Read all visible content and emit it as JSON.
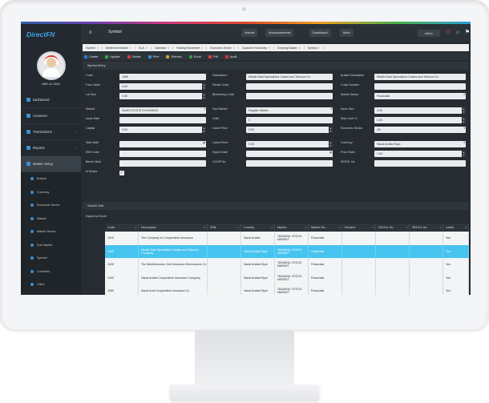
{
  "app": {
    "logo": "DirectFN",
    "breadcrumb": "Symbol",
    "top_buttons": [
      "Actions",
      "Announcements",
      "Dashboard",
      "More"
    ],
    "user_menu": "Admin"
  },
  "user": {
    "name": "ABD AL BAS"
  },
  "sidebar": {
    "items": [
      {
        "label": "Dashboard"
      },
      {
        "label": "Customer"
      },
      {
        "label": "Transactions"
      },
      {
        "label": "Reports"
      },
      {
        "label": "Master Setup"
      }
    ],
    "sub_items": [
      "Branch",
      "Currency",
      "Economic Sector",
      "Market",
      "Market Sector",
      "Sub Market",
      "Symbol",
      "Countries",
      "Cities"
    ]
  },
  "tabs": [
    "Symbol",
    "Settlement Master",
    "SLA",
    "Calendar",
    "Holding Movement",
    "Economic Sector",
    "Customer Summary",
    "Clearing Master",
    "Symbol"
  ],
  "actions": [
    {
      "label": "Create",
      "color": "#2a7bd0"
    },
    {
      "label": "Update",
      "color": "#3aa845"
    },
    {
      "label": "Delete",
      "color": "#d83a3a"
    },
    {
      "label": "Print",
      "color": "#3a8fd6"
    },
    {
      "label": "Refresh",
      "color": "#d8a23a"
    },
    {
      "label": "Excel",
      "color": "#2e9a48"
    },
    {
      "label": "Pdf",
      "color": "#d8443a"
    },
    {
      "label": "Audit",
      "color": "#c93a3a"
    }
  ],
  "form": {
    "title": "Symbol Entry",
    "fields": {
      "code": {
        "label": "Code",
        "value": "1050"
      },
      "face_value": {
        "label": "Face Value",
        "value": "0.00"
      },
      "lot_size": {
        "label": "Lot Size",
        "value": "0.00"
      },
      "market": {
        "label": "Market",
        "value": "SAUDI STOCK EXCHANGE"
      },
      "issue_date": {
        "label": "Issue Date",
        "value": ""
      },
      "capital": {
        "label": "Capital",
        "value": "0.00"
      },
      "start_date": {
        "label": "Start Date",
        "value": ""
      },
      "isin_code": {
        "label": "ISIN Code",
        "value": ""
      },
      "bench_mark": {
        "label": "Bench Mark",
        "value": ""
      },
      "is_shariya": {
        "label": "Is Sharia"
      },
      "description": {
        "label": "Description",
        "value": "Middle East Specialized Cables and Telecom Co"
      },
      "reuter_code": {
        "label": "Reuter Code",
        "value": ""
      },
      "bloomberg_code": {
        "label": "Bloomberg Code",
        "value": ""
      },
      "sub_market": {
        "label": "Sub Market",
        "value": "Regular Market"
      },
      "units": {
        "label": "Units",
        "value": "0"
      },
      "listed_price": {
        "label": "Listed Price",
        "value": "0.00"
      },
      "listed_price2": {
        "label": "Listed Price",
        "value": "0.00"
      },
      "expire_date": {
        "label": "Expire Date",
        "value": ""
      },
      "cusip_no": {
        "label": "CUSIP No",
        "value": ""
      },
      "arabic_desc": {
        "label": "Arabic Description",
        "value": "Middle East Specialized Cables and Telecom Co"
      },
      "cusip_number": {
        "label": "Cusip Number",
        "value": ""
      },
      "market_sector": {
        "label": "Market Sector",
        "value": "Financials"
      },
      "issue_size": {
        "label": "Issue Size",
        "value": "0.00"
      },
      "step_limit": {
        "label": "Step Limit %",
        "value": "0.00"
      },
      "economic_sector": {
        "label": "Economic Sector",
        "value": "Oil"
      },
      "currency": {
        "label": "Currency",
        "value": "Saudi Arabia Riyal"
      },
      "price_ratio": {
        "label": "Price Ratio",
        "value": "1.00"
      },
      "sedol_no": {
        "label": "SEDOL No",
        "value": ""
      }
    }
  },
  "table": {
    "section_title": "Search Grid",
    "export_label": "Export to Excel",
    "columns": [
      "Code",
      "Description",
      "ISIN",
      "Country",
      "Market",
      "Market Se...",
      "Reuters",
      "SEDOL No",
      "SEDOL No",
      "Listed"
    ],
    "rows": [
      [
        "1010",
        "The Company for Cooperative Insurance",
        "",
        "Saudi Arabia",
        "TADAWUL STOCK MARKET",
        "Financials",
        "",
        "",
        "",
        "Yes"
      ],
      [
        "1020",
        "Middle East Specialized Cables and Telecom Company",
        "",
        "Saudi Arabia Riyal",
        "TADAWUL STOCK MARKET",
        "Financials",
        "",
        "",
        "",
        "Yes"
      ],
      [
        "1030",
        "The Mediterranean Gulf Insurance Reinsurance Co",
        "",
        "Saudi Arabia Riyal",
        "TADAWUL STOCK MARKET",
        "Financials",
        "",
        "",
        "",
        "Yes"
      ],
      [
        "1040",
        "Saudi Arabia Cooperative Insurance Company",
        "",
        "Saudi Arabia Riyal",
        "TADAWUL STOCK MARKET",
        "Financials",
        "",
        "",
        "",
        "Yes"
      ],
      [
        "1050",
        "Saudi Arab Cooperative Insurance Co",
        "",
        "Saudi Arabia Riyal",
        "TADAWUL STOCK MARKET",
        "Financials",
        "",
        "",
        "",
        "Yes"
      ]
    ]
  }
}
